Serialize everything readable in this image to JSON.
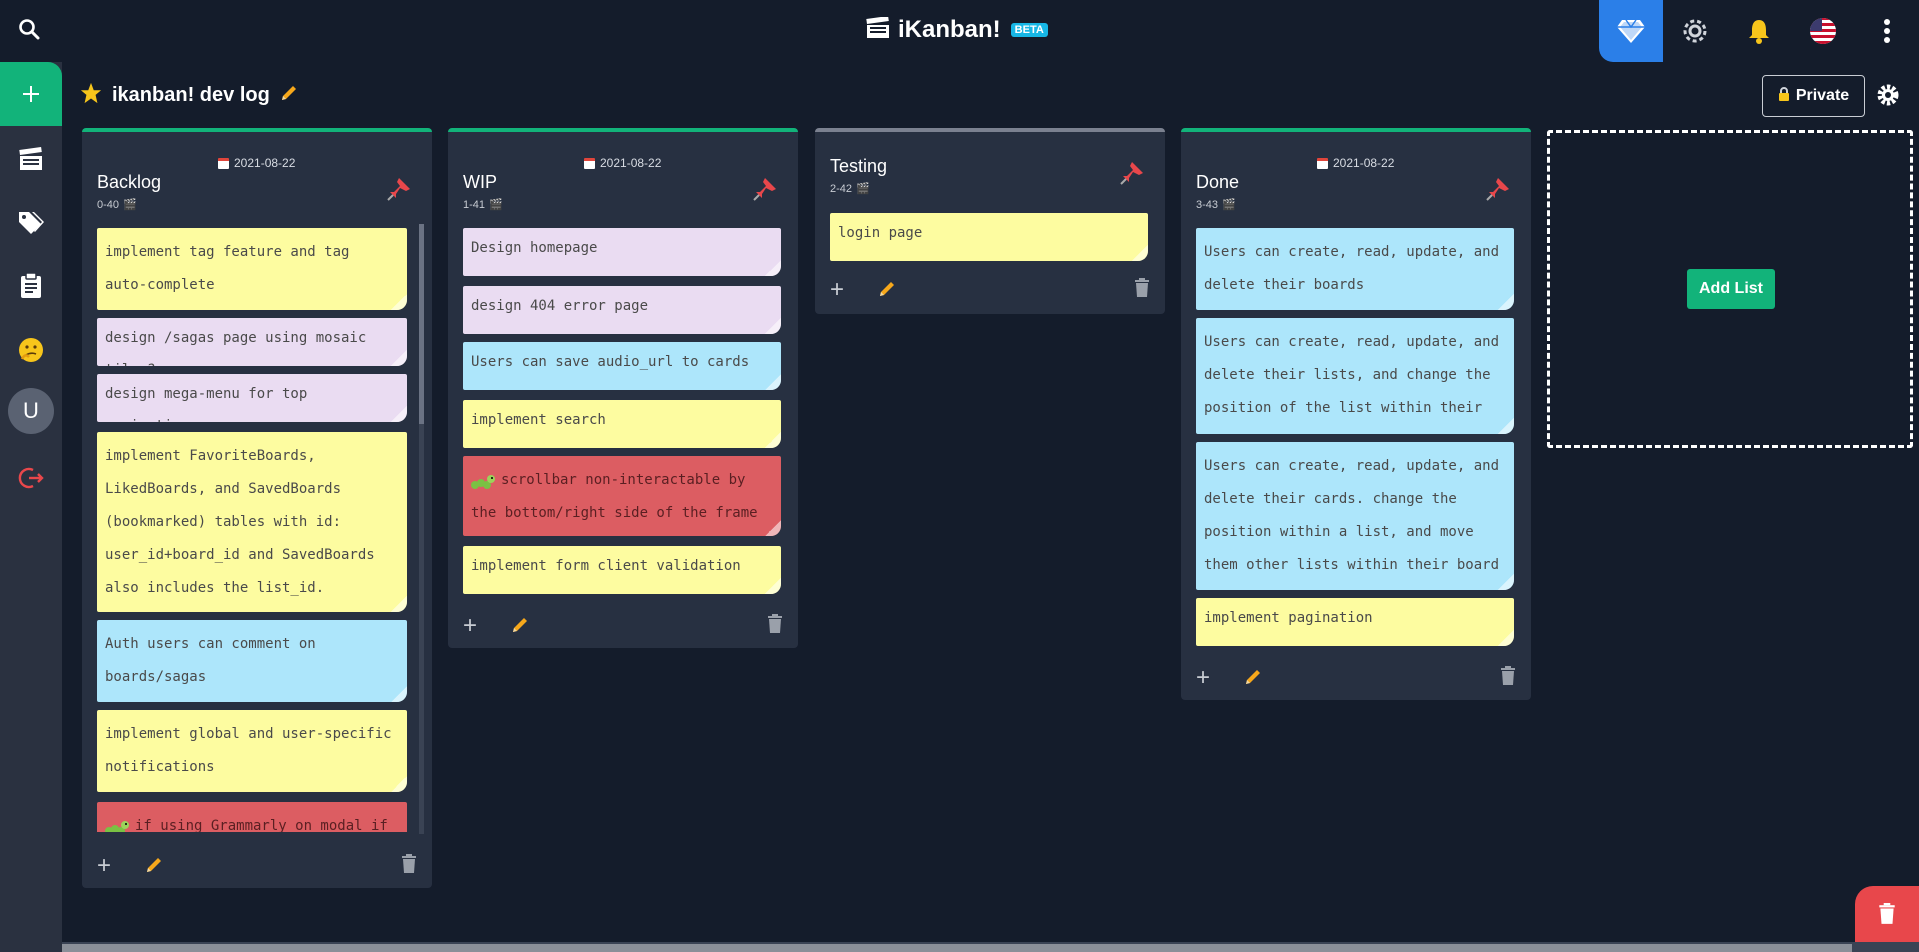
{
  "app": {
    "title": "iKanban!",
    "badge": "BETA"
  },
  "topbar": {
    "icons": [
      "search-icon",
      "diamond-icon",
      "brightness-icon",
      "bell-icon",
      "us-flag-icon",
      "kebab-menu-icon"
    ]
  },
  "sidebar": {
    "items": [
      {
        "name": "add-board",
        "icon": "plus-icon"
      },
      {
        "name": "boards",
        "icon": "clapperboard-icon"
      },
      {
        "name": "tags",
        "icon": "tags-icon"
      },
      {
        "name": "clipboard",
        "icon": "clipboard-icon"
      },
      {
        "name": "help",
        "icon": "thinking-face-icon"
      },
      {
        "name": "user",
        "avatar_letter": "U"
      },
      {
        "name": "logout",
        "icon": "logout-icon"
      }
    ]
  },
  "board": {
    "title": "ikanban! dev log",
    "visibility_label": "Private"
  },
  "lists": [
    {
      "title": "Backlog",
      "date": "2021-08-22",
      "meta": "0-40",
      "cards": [
        {
          "text": "implement tag feature and tag auto-complete",
          "color": "yellow"
        },
        {
          "text": "design /sagas page using mosaic tiles?",
          "color": "pink"
        },
        {
          "text": "design mega-menu for top navigation",
          "color": "pink"
        },
        {
          "text": "implement FavoriteBoards, LikedBoards, and SavedBoards (bookmarked) tables with id: user_id+board_id and SavedBoards also includes the list_id.",
          "color": "yellow"
        },
        {
          "text": "Auth users can comment on boards/sagas",
          "color": "blue"
        },
        {
          "text": "implement global and user-specific notifications",
          "color": "yellow"
        },
        {
          "text": "if using Grammarly on modal if",
          "color": "red",
          "bug": true
        }
      ]
    },
    {
      "title": "WIP",
      "date": "2021-08-22",
      "meta": "1-41",
      "cards": [
        {
          "text": "Design homepage",
          "color": "pink"
        },
        {
          "text": "design 404 error page",
          "color": "pink"
        },
        {
          "text": "Users can save audio_url to cards",
          "color": "blue"
        },
        {
          "text": "implement search",
          "color": "yellow"
        },
        {
          "text": "scrollbar non-interactable by the bottom/right side of the frame layout",
          "color": "red",
          "bug": true
        },
        {
          "text": "implement form client validation",
          "color": "yellow"
        }
      ]
    },
    {
      "title": "Testing",
      "date": "",
      "meta": "2-42",
      "cards": [
        {
          "text": "login page",
          "color": "yellow"
        }
      ]
    },
    {
      "title": "Done",
      "date": "2021-08-22",
      "meta": "3-43",
      "cards": [
        {
          "text": "Users can create, read, update, and delete their boards",
          "color": "blue"
        },
        {
          "text": "Users can create, read, update, and delete their lists, and change the position of the list within their board",
          "color": "blue"
        },
        {
          "text": "Users can create, read, update, and delete their cards. change the position within a list, and move them other lists within their board",
          "color": "blue"
        },
        {
          "text": "implement pagination",
          "color": "yellow"
        }
      ]
    }
  ],
  "add_list": {
    "label": "Add List"
  },
  "colors": {
    "accent_green": "#12b37a",
    "accent_blue": "#2b7fe8",
    "background": "#141c2b",
    "list_bg": "#273041",
    "card_yellow": "#fdfca0",
    "card_pink": "#eadcf2",
    "card_blue": "#ade6fb",
    "card_red": "#dc5d62",
    "danger": "#e8474b"
  }
}
